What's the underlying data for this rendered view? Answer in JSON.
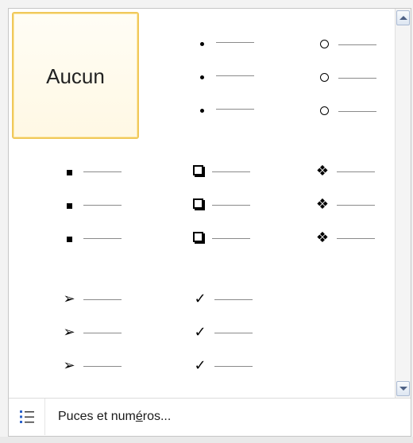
{
  "bullet_library": {
    "none_label": "Aucun",
    "cells": [
      {
        "id": "none",
        "glyph": "",
        "icon": "none",
        "selected": true
      },
      {
        "id": "small-dot",
        "glyph": "•",
        "icon": "filled-dot-bullet"
      },
      {
        "id": "hollow-circle",
        "glyph": "○",
        "icon": "hollow-circle-bullet"
      },
      {
        "id": "small-square",
        "glyph": "▪",
        "icon": "filled-square-bullet"
      },
      {
        "id": "shadow-box",
        "glyph": "❑",
        "icon": "shadowed-box-bullet"
      },
      {
        "id": "four-diamond",
        "glyph": "❖",
        "icon": "four-diamond-bullet"
      },
      {
        "id": "arrowhead",
        "glyph": "➢",
        "icon": "arrowhead-bullet"
      },
      {
        "id": "checkmark",
        "glyph": "✓",
        "icon": "checkmark-bullet"
      }
    ]
  },
  "footer": {
    "label_before": "Puces et num",
    "label_underlined": "é",
    "label_after": "ros...",
    "icon": "bullet-list-icon"
  },
  "colors": {
    "selection_border": "#f0c85b",
    "scroll_arrow": "#4d6185",
    "footer_icon": "#2c62c9"
  }
}
